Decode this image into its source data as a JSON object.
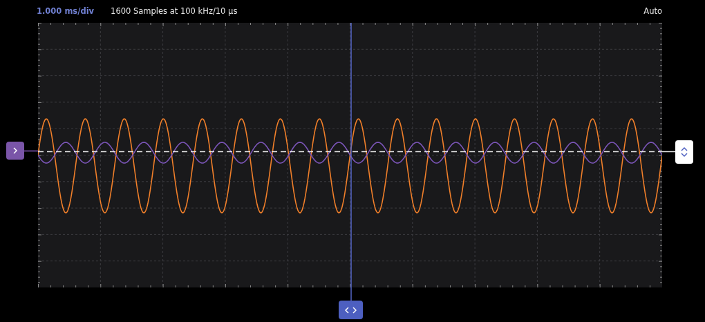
{
  "header": {
    "timebase": "1.000 ms/div",
    "sample_info": "1600 Samples at 100 kHz/10 µs",
    "trigger_mode": "Auto"
  }
}
